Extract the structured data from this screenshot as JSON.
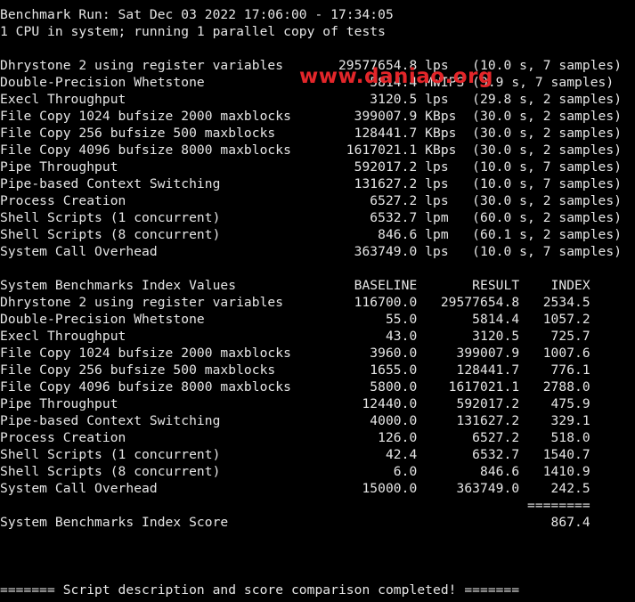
{
  "terminal": {
    "lines": [
      "Benchmark Run: Sat Dec 03 2022 17:06:00 - 17:34:05",
      "1 CPU in system; running 1 parallel copy of tests",
      "",
      "Dhrystone 2 using register variables       29577654.8 lps   (10.0 s, 7 samples)",
      "Double-Precision Whetstone                     5814.4 MWIPS (9.9 s, 7 samples)",
      "Execl Throughput                               3120.5 lps   (29.8 s, 2 samples)",
      "File Copy 1024 bufsize 2000 maxblocks        399007.9 KBps  (30.0 s, 2 samples)",
      "File Copy 256 bufsize 500 maxblocks          128441.7 KBps  (30.0 s, 2 samples)",
      "File Copy 4096 bufsize 8000 maxblocks       1617021.1 KBps  (30.0 s, 2 samples)",
      "Pipe Throughput                              592017.2 lps   (10.0 s, 7 samples)",
      "Pipe-based Context Switching                 131627.2 lps   (10.0 s, 7 samples)",
      "Process Creation                               6527.2 lps   (30.0 s, 2 samples)",
      "Shell Scripts (1 concurrent)                   6532.7 lpm   (60.0 s, 2 samples)",
      "Shell Scripts (8 concurrent)                    846.6 lpm   (60.1 s, 2 samples)",
      "System Call Overhead                         363749.0 lps   (10.0 s, 7 samples)",
      "",
      "System Benchmarks Index Values               BASELINE       RESULT    INDEX",
      "Dhrystone 2 using register variables         116700.0   29577654.8   2534.5",
      "Double-Precision Whetstone                       55.0       5814.4   1057.2",
      "Execl Throughput                                 43.0       3120.5    725.7",
      "File Copy 1024 bufsize 2000 maxblocks          3960.0     399007.9   1007.6",
      "File Copy 256 bufsize 500 maxblocks            1655.0     128441.7    776.1",
      "File Copy 4096 bufsize 8000 maxblocks          5800.0    1617021.1   2788.0",
      "Pipe Throughput                               12440.0     592017.2    475.9",
      "Pipe-based Context Switching                   4000.0     131627.2    329.1",
      "Process Creation                                126.0       6527.2    518.0",
      "Shell Scripts (1 concurrent)                     42.4       6532.7   1540.7",
      "Shell Scripts (8 concurrent)                      6.0        846.6   1410.9",
      "System Call Overhead                          15000.0     363749.0    242.5",
      "                                                                   ========",
      "System Benchmarks Index Score                                         867.4",
      "",
      "",
      "",
      "======= Script description and score comparison completed! ======="
    ]
  },
  "watermark": {
    "text": "www.daniao.org",
    "color": "#e3262a"
  },
  "colors": {
    "background": "#000000",
    "foreground": "#e6e6e6"
  }
}
